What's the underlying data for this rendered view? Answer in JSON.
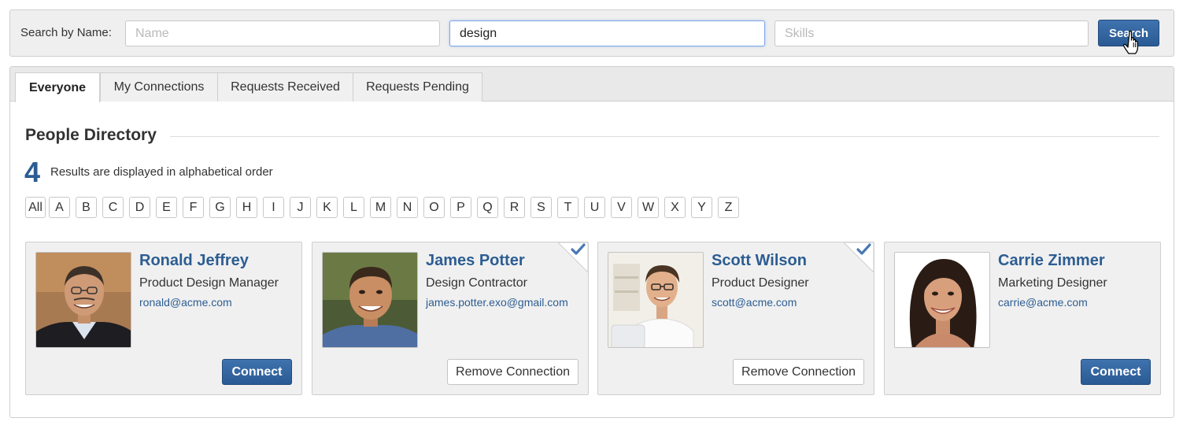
{
  "search": {
    "label": "Search by Name:",
    "name_placeholder": "Name",
    "keyword_value": "design",
    "skills_placeholder": "Skills",
    "button_label": "Search"
  },
  "tabs": [
    {
      "label": "Everyone",
      "active": true
    },
    {
      "label": "My Connections",
      "active": false
    },
    {
      "label": "Requests Received",
      "active": false
    },
    {
      "label": "Requests Pending",
      "active": false
    }
  ],
  "directory": {
    "title": "People Directory",
    "result_count": "4",
    "result_text": "Results are displayed in alphabetical order"
  },
  "letters": [
    "All",
    "A",
    "B",
    "C",
    "D",
    "E",
    "F",
    "G",
    "H",
    "I",
    "J",
    "K",
    "L",
    "M",
    "N",
    "O",
    "P",
    "Q",
    "R",
    "S",
    "T",
    "U",
    "V",
    "W",
    "X",
    "Y",
    "Z"
  ],
  "people": [
    {
      "name": "Ronald Jeffrey",
      "role": "Product Design Manager",
      "email": "ronald@acme.com",
      "connected": false,
      "action_label": "Connect"
    },
    {
      "name": "James Potter",
      "role": "Design Contractor",
      "email": "james.potter.exo@gmail.com",
      "connected": true,
      "action_label": "Remove Connection"
    },
    {
      "name": "Scott Wilson",
      "role": "Product Designer",
      "email": "scott@acme.com",
      "connected": true,
      "action_label": "Remove Connection"
    },
    {
      "name": "Carrie Zimmer",
      "role": "Marketing Designer",
      "email": "carrie@acme.com",
      "connected": false,
      "action_label": "Connect"
    }
  ],
  "colors": {
    "accent": "#2c5d92",
    "button": "#2f63a0",
    "panel": "#efefef",
    "check": "#4a78b5"
  }
}
